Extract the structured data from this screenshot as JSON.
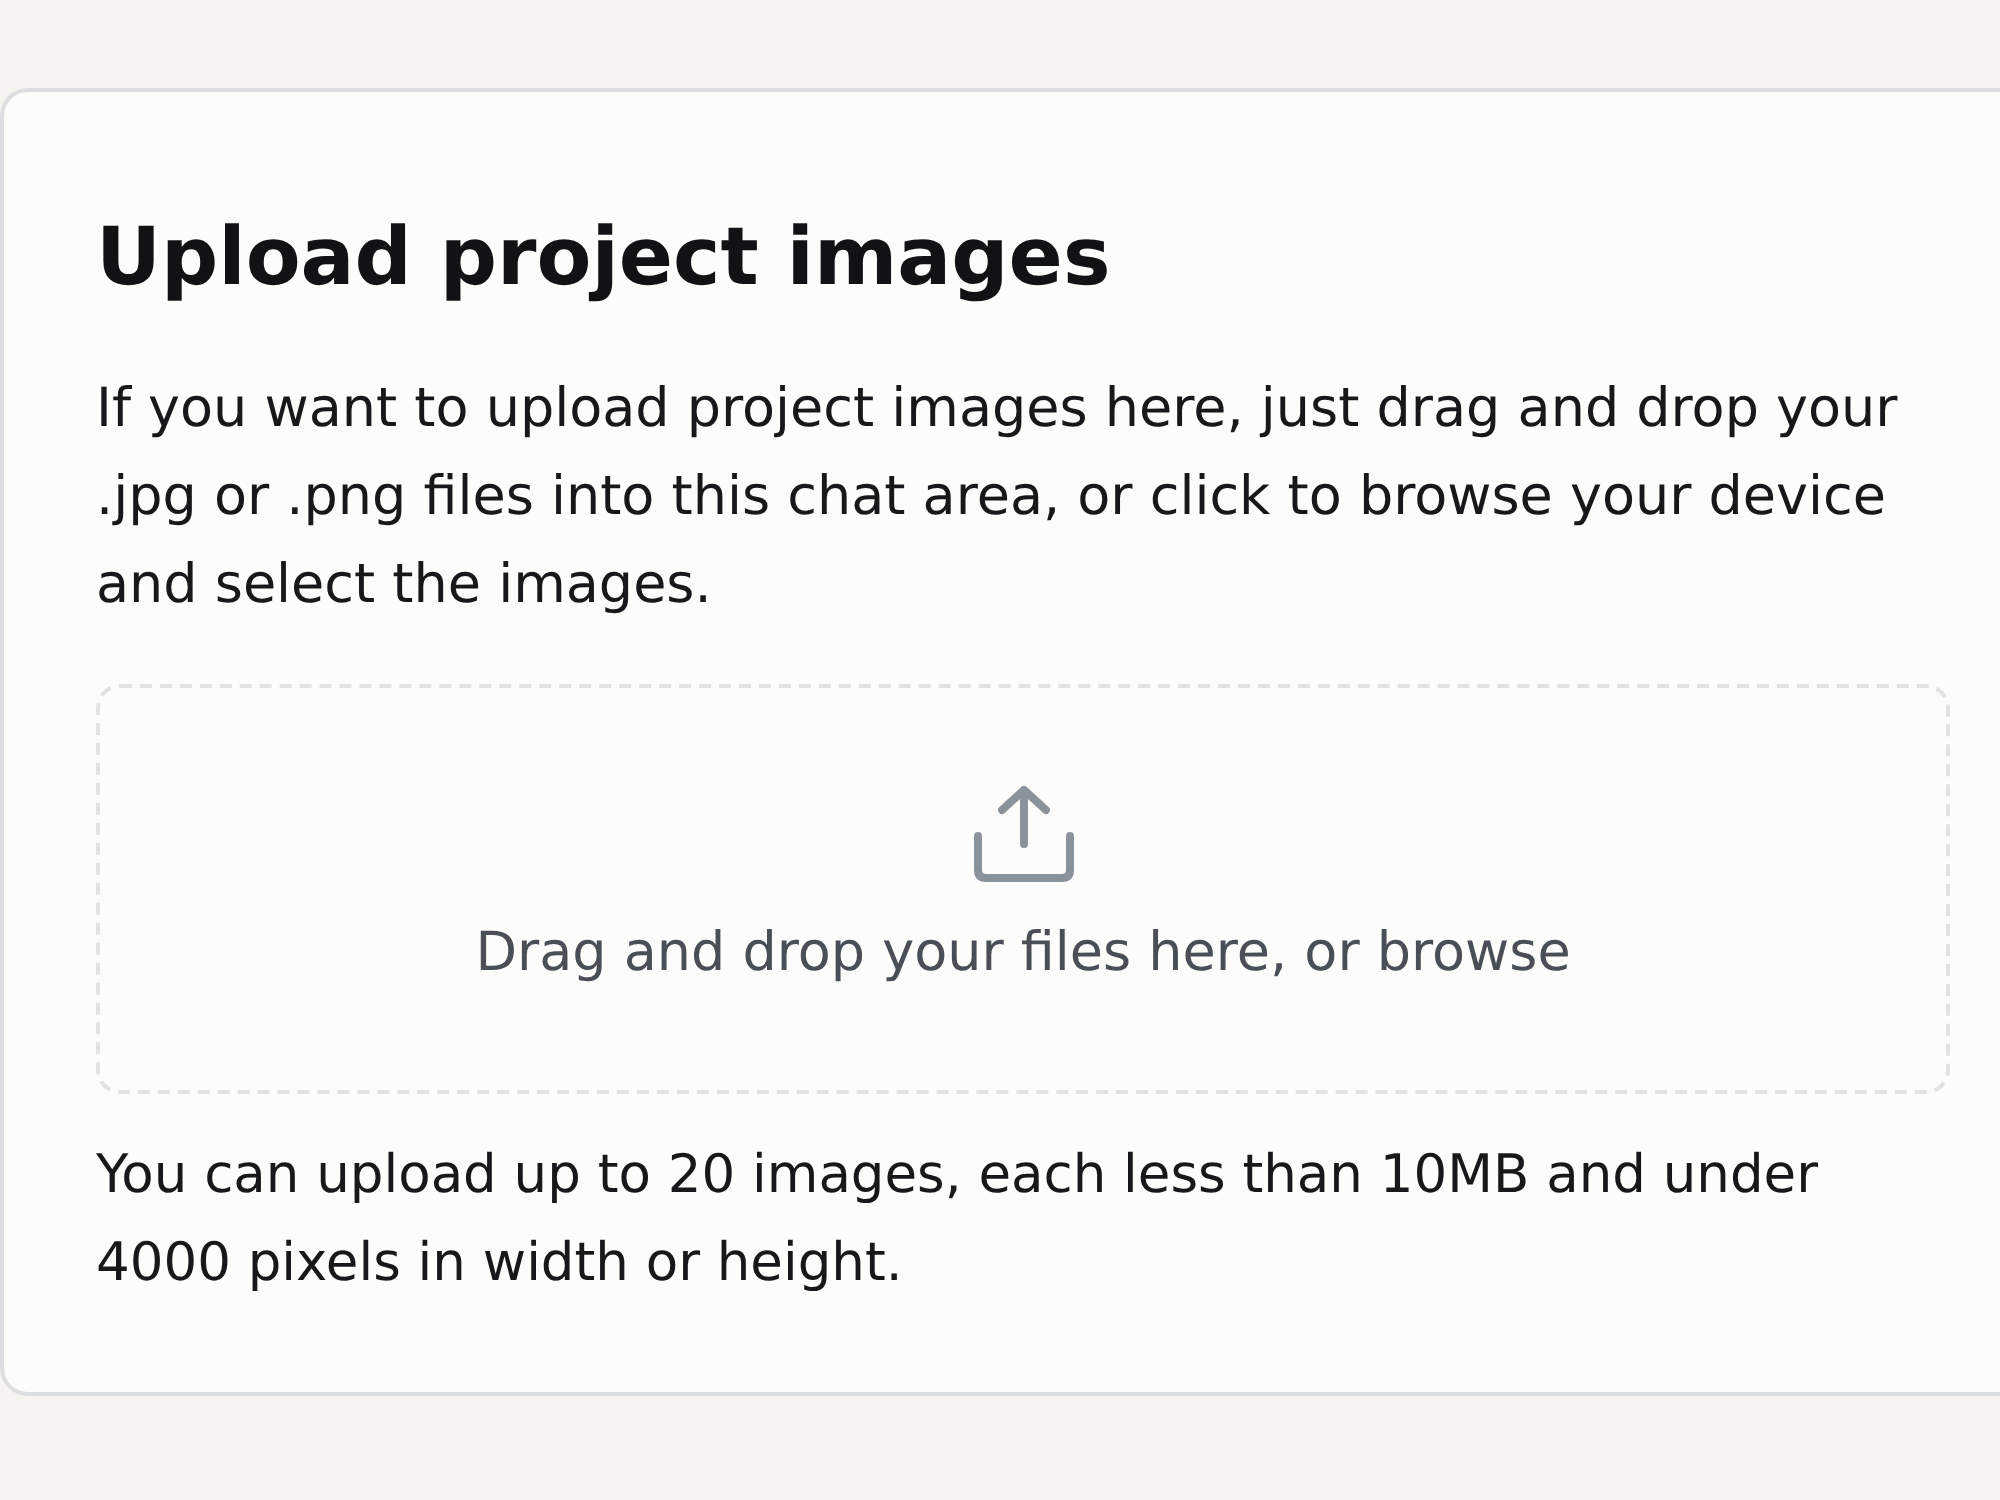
{
  "card": {
    "title": "Upload project images",
    "description": "If you want to upload project images here, just drag and drop your .jpg or .png files into this chat area, or click to browse your device and select the images.",
    "dropzone": {
      "text": "Drag and drop your files here, or browse"
    },
    "note": "You can upload up to 20 images, each less than 10MB and under 4000 pixels in width or height."
  }
}
